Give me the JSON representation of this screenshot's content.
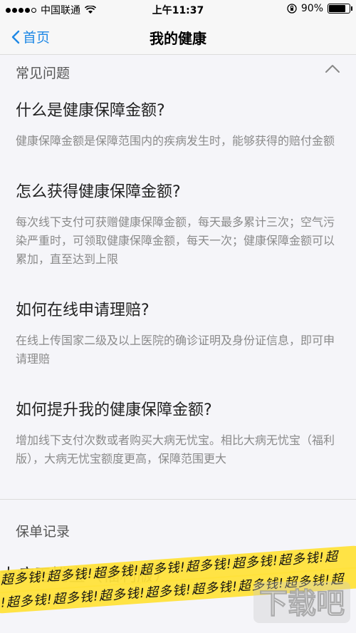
{
  "status_bar": {
    "carrier": "中国联通",
    "time": "上午11:37",
    "battery_percent": "90%",
    "battery_level": 0.9
  },
  "nav": {
    "back_label": "首页",
    "title": "我的健康"
  },
  "faq": {
    "header": "常见问题",
    "items": [
      {
        "q": "什么是健康保障金额?",
        "a": "健康保障金额是保障范围内的疾病发生时，能够获得的赔付金额"
      },
      {
        "q": "怎么获得健康保障金额?",
        "a": "每次线下支付可获赠健康保障金额，每天最多累计三次；空气污染严重时，可领取健康保障金额，每天一次；健康保障金额可以累加，直至达到上限"
      },
      {
        "q": "如何在线申请理赔?",
        "a": "在线上传国家二级及以上医院的确诊证明及身份证信息，即可申请理赔"
      },
      {
        "q": "如何提升我的健康保障金额?",
        "a": "增加线下支付次数或者购买大病无忧宝。相比大病无忧宝（福利版），大病无忧宝额度更高，保障范围更大"
      }
    ]
  },
  "policy": {
    "header": "保单记录",
    "row_partial": "大病无忧宝（福利版）",
    "scribble_1": "超多钱!超多钱!超多钱!超多钱!超多钱!超多钱!超多钱!超",
    "scribble_2": "!超多钱!超多钱!超多钱!超多钱!超多钱!超多钱!超多钱!超"
  },
  "watermark": {
    "text": "下载吧"
  },
  "colors": {
    "accent": "#1e88e5",
    "highlighter": "#ffe23b"
  }
}
